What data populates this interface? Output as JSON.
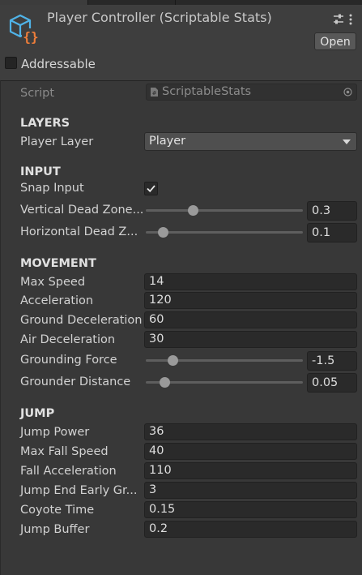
{
  "header": {
    "title": "Player Controller (Scriptable Stats)",
    "open_label": "Open",
    "addressable_label": "Addressable",
    "addressable_checked": false,
    "icon": "scriptable-object-icon"
  },
  "script": {
    "label": "Script",
    "value": "ScriptableStats"
  },
  "layers": {
    "heading": "LAYERS",
    "player_layer_label": "Player Layer",
    "player_layer_value": "Player"
  },
  "input": {
    "heading": "INPUT",
    "snap_input_label": "Snap Input",
    "snap_input_checked": true,
    "vertical_label": "Vertical Dead Zone...",
    "vertical_value": "0.3",
    "vertical_fraction": 0.3,
    "horizontal_label": "Horizontal Dead Z...",
    "horizontal_value": "0.1",
    "horizontal_fraction": 0.11
  },
  "movement": {
    "heading": "MOVEMENT",
    "max_speed_label": "Max Speed",
    "max_speed_value": "14",
    "acceleration_label": "Acceleration",
    "acceleration_value": "120",
    "ground_decel_label": "Ground Deceleration",
    "ground_decel_value": "60",
    "air_decel_label": "Air Deceleration",
    "air_decel_value": "30",
    "grounding_force_label": "Grounding Force",
    "grounding_force_value": "-1.5",
    "grounding_force_fraction": 0.17,
    "grounder_distance_label": "Grounder Distance",
    "grounder_distance_value": "0.05",
    "grounder_distance_fraction": 0.12
  },
  "jump": {
    "heading": "JUMP",
    "jump_power_label": "Jump Power",
    "jump_power_value": "36",
    "max_fall_speed_label": "Max Fall Speed",
    "max_fall_speed_value": "40",
    "fall_accel_label": "Fall Acceleration",
    "fall_accel_value": "110",
    "jump_end_early_label": "Jump End Early Gr...",
    "jump_end_early_value": "3",
    "coyote_time_label": "Coyote Time",
    "coyote_time_value": "0.15",
    "jump_buffer_label": "Jump Buffer",
    "jump_buffer_value": "0.2"
  }
}
